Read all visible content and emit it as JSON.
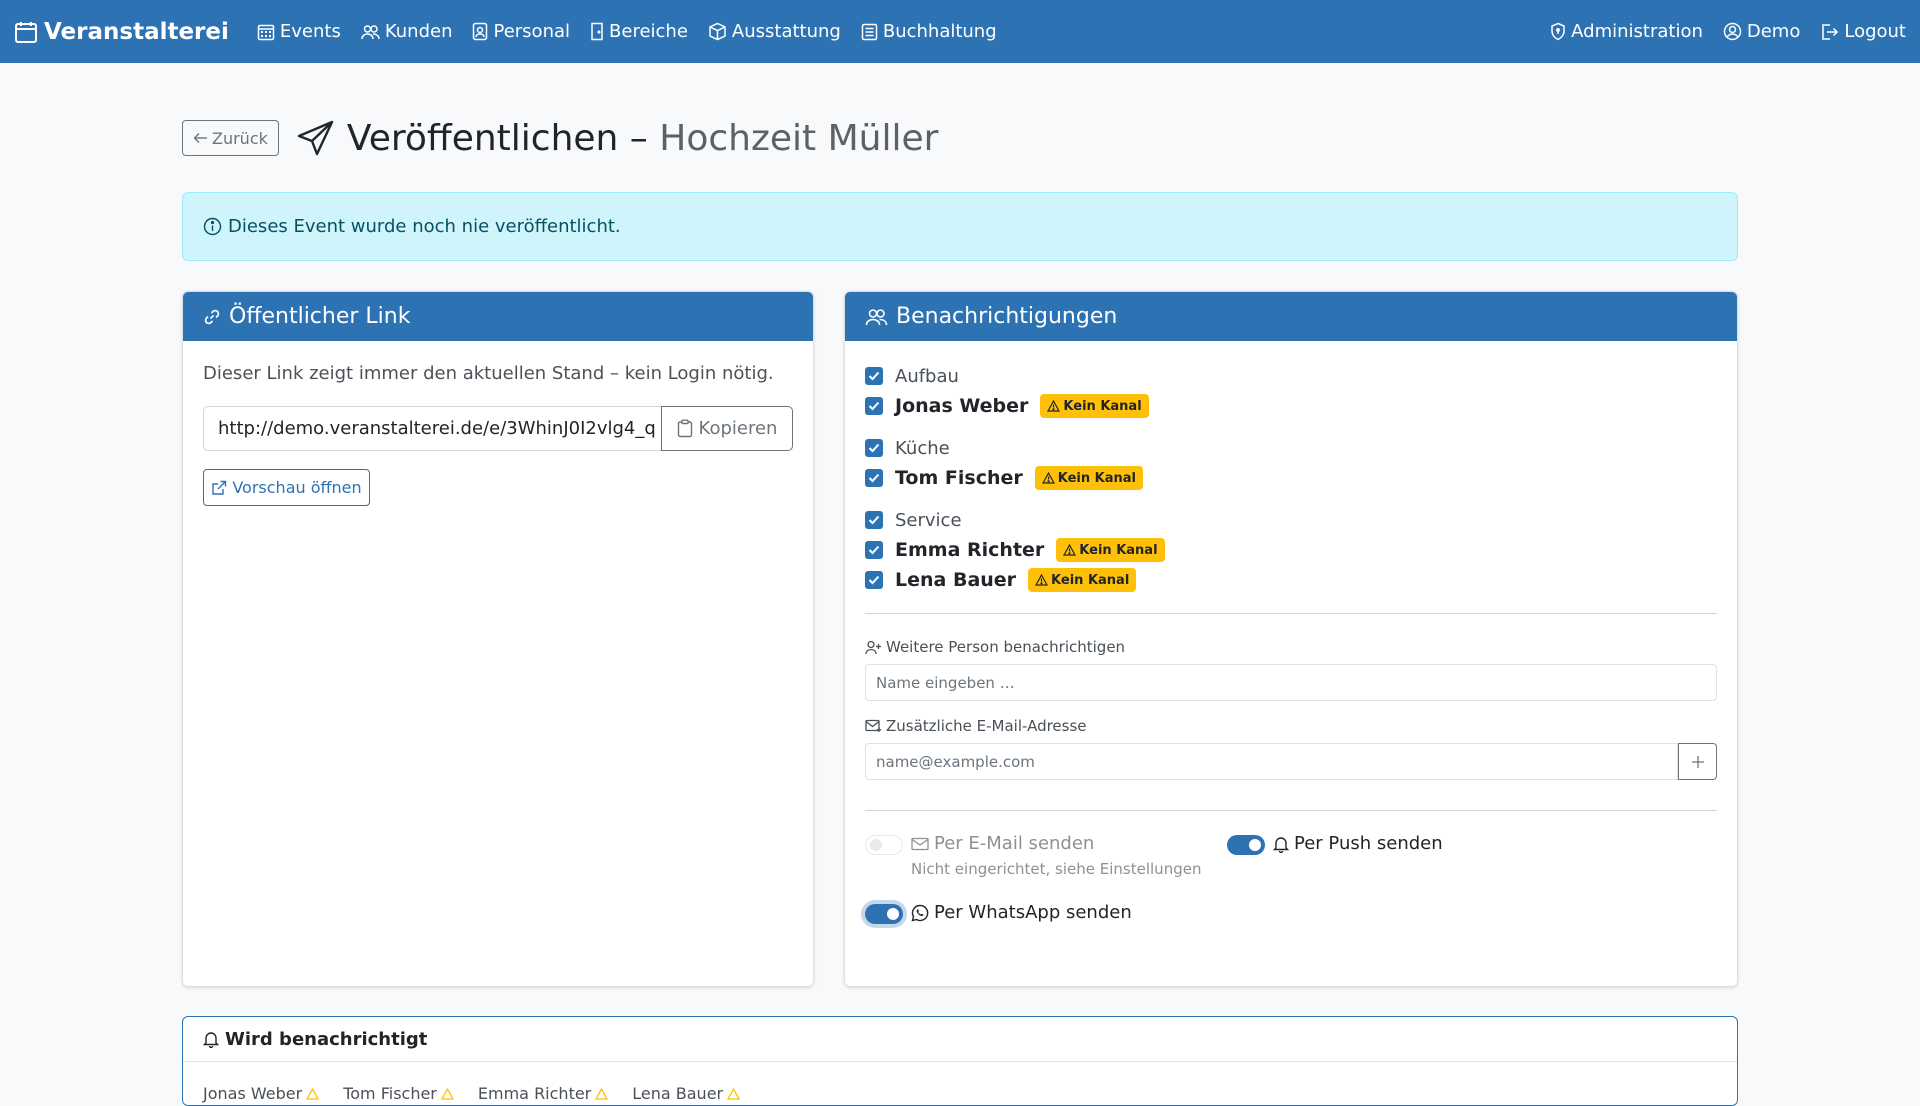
{
  "nav": {
    "brand": "Veranstalterei",
    "items": [
      {
        "label": "Events",
        "icon": "calendar-grid-icon"
      },
      {
        "label": "Kunden",
        "icon": "people-icon"
      },
      {
        "label": "Personal",
        "icon": "person-badge-icon"
      },
      {
        "label": "Bereiche",
        "icon": "door-icon"
      },
      {
        "label": "Ausstattung",
        "icon": "box-icon"
      },
      {
        "label": "Buchhaltung",
        "icon": "ledger-icon"
      }
    ],
    "right": [
      {
        "label": "Administration",
        "icon": "shield-icon"
      },
      {
        "label": "Demo",
        "icon": "user-circle-icon"
      },
      {
        "label": "Logout",
        "icon": "logout-icon"
      }
    ]
  },
  "header": {
    "back_label": "Zurück",
    "title": "Veröffentlichen –",
    "event_name": "Hochzeit Müller"
  },
  "alert": {
    "text": "Dieses Event wurde noch nie veröffentlicht."
  },
  "public_link": {
    "title": "Öffentlicher Link",
    "description": "Dieser Link zeigt immer den aktuellen Stand – kein Login nötig.",
    "url": "http://demo.veranstalterei.de/e/3WhinJ0I2vlg4_q",
    "copy_label": "Kopieren",
    "preview_label": "Vorschau öffnen"
  },
  "notifications": {
    "title": "Benachrichtigungen",
    "badge_label": "Kein Kanal",
    "groups": [
      {
        "name": "Aufbau",
        "people": [
          "Jonas Weber"
        ]
      },
      {
        "name": "Küche",
        "people": [
          "Tom Fischer"
        ]
      },
      {
        "name": "Service",
        "people": [
          "Emma Richter",
          "Lena Bauer"
        ]
      }
    ],
    "more_person_label": "Weitere Person benachrichtigen",
    "more_person_placeholder": "Name eingeben …",
    "extra_email_label": "Zusätzliche E-Mail-Adresse",
    "extra_email_placeholder": "name@example.com",
    "email_switch": {
      "label": "Per E-Mail senden",
      "hint": "Nicht eingerichtet, siehe Einstellungen",
      "on": false
    },
    "push_switch": {
      "label": "Per Push senden",
      "on": true
    },
    "whatsapp_switch": {
      "label": "Per WhatsApp senden",
      "on": true
    }
  },
  "recipients": {
    "title": "Wird benachrichtigt",
    "names": [
      "Jonas Weber",
      "Tom Fischer",
      "Emma Richter",
      "Lena Bauer"
    ]
  },
  "colors": {
    "primary": "#2d73b4",
    "warning": "#ffc107",
    "info_bg": "#cff4fc"
  }
}
